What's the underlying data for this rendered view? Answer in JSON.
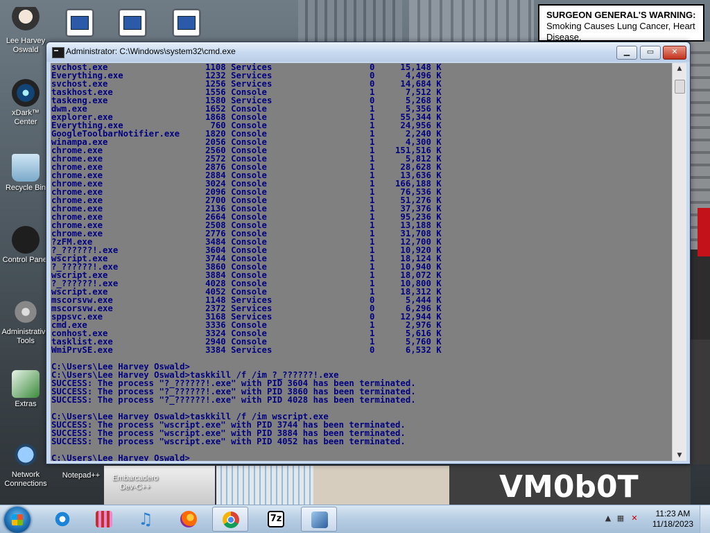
{
  "desktop": {
    "icons": [
      {
        "label": "Lee Harvey Oswald"
      },
      {
        "label": "xDark™ Center"
      },
      {
        "label": "Recycle Bin"
      },
      {
        "label": "Control Panel"
      },
      {
        "label": "Administrative Tools"
      },
      {
        "label": "Extras"
      },
      {
        "label": "Network Connections"
      },
      {
        "label": "Notepad++"
      },
      {
        "label": "Embarcadero Dev-C++"
      }
    ],
    "warning_bold": "SURGEON GENERAL'S WARNING:",
    "warning_rest": " Smoking Causes Lung Cancer, Heart Disease,",
    "wallpaper_text": "VM0b0T"
  },
  "window": {
    "title": "Administrator: C:\\Windows\\system32\\cmd.exe",
    "min": "▁",
    "max": "▭",
    "close": "✕"
  },
  "console": {
    "lines": [
      "svchost.exe                   1108 Services                   0     15,148 K",
      "Everything.exe                1232 Services                   0      4,496 K",
      "svchost.exe                   1256 Services                   0     14,684 K",
      "taskhost.exe                  1556 Console                    1      7,512 K",
      "taskeng.exe                   1580 Services                   0      5,268 K",
      "dwm.exe                       1652 Console                    1      5,356 K",
      "explorer.exe                  1868 Console                    1     55,344 K",
      "Everything.exe                 760 Console                    1     24,956 K",
      "GoogleToolbarNotifier.exe     1820 Console                    1      2,240 K",
      "winampa.exe                   2056 Console                    1      4,300 K",
      "chrome.exe                    2560 Console                    1    151,516 K",
      "chrome.exe                    2572 Console                    1      5,812 K",
      "chrome.exe                    2876 Console                    1     28,628 K",
      "chrome.exe                    2884 Console                    1     13,636 K",
      "chrome.exe                    3024 Console                    1    166,188 K",
      "chrome.exe                    2096 Console                    1     76,536 K",
      "chrome.exe                    2700 Console                    1     51,276 K",
      "chrome.exe                    2136 Console                    1     37,376 K",
      "chrome.exe                    2664 Console                    1     95,236 K",
      "chrome.exe                    2508 Console                    1     13,188 K",
      "chrome.exe                    2776 Console                    1     31,708 K",
      "?zFM.exe                      3484 Console                    1     12,700 K",
      "?_??????!.exe                 3604 Console                    1     10,920 K",
      "wscript.exe                   3744 Console                    1     18,124 K",
      "?_??????!.exe                 3860 Console                    1     10,940 K",
      "wscript.exe                   3884 Console                    1     18,072 K",
      "?_??????!.exe                 4028 Console                    1     10,800 K",
      "wscript.exe                   4052 Console                    1     18,312 K",
      "mscorsvw.exe                  1148 Services                   0      5,444 K",
      "mscorsvw.exe                  2372 Services                   0      6,296 K",
      "sppsvc.exe                    3168 Services                   0     12,944 K",
      "cmd.exe                       3336 Console                    1      2,976 K",
      "conhost.exe                   3324 Console                    1      5,616 K",
      "tasklist.exe                  2940 Console                    1      5,760 K",
      "WmiPrvSE.exe                  3384 Services                   0      6,532 K",
      "",
      "C:\\Users\\Lee Harvey Oswald>",
      "C:\\Users\\Lee Harvey Oswald>taskkill /f /im ?_??????!.exe",
      "SUCCESS: The process \"?_??????!.exe\" with PID 3604 has been terminated.",
      "SUCCESS: The process \"?_??????!.exe\" with PID 3860 has been terminated.",
      "SUCCESS: The process \"?_??????!.exe\" with PID 4028 has been terminated.",
      "",
      "C:\\Users\\Lee Harvey Oswald>taskkill /f /im wscript.exe",
      "SUCCESS: The process \"wscript.exe\" with PID 3744 has been terminated.",
      "SUCCESS: The process \"wscript.exe\" with PID 3884 has been terminated.",
      "SUCCESS: The process \"wscript.exe\" with PID 4052 has been terminated.",
      "",
      "C:\\Users\\Lee Harvey Oswald>"
    ]
  },
  "taskbar": {
    "buttons": [
      {
        "icon": "internet-explorer-icon"
      },
      {
        "icon": "program-manager-icon"
      },
      {
        "icon": "itunes-icon"
      },
      {
        "icon": "firefox-icon"
      },
      {
        "icon": "chrome-icon"
      },
      {
        "icon": "7zip-icon",
        "text": "7z"
      },
      {
        "icon": "cmd-icon"
      }
    ],
    "time": "11:23 AM",
    "date": "11/18/2023"
  }
}
